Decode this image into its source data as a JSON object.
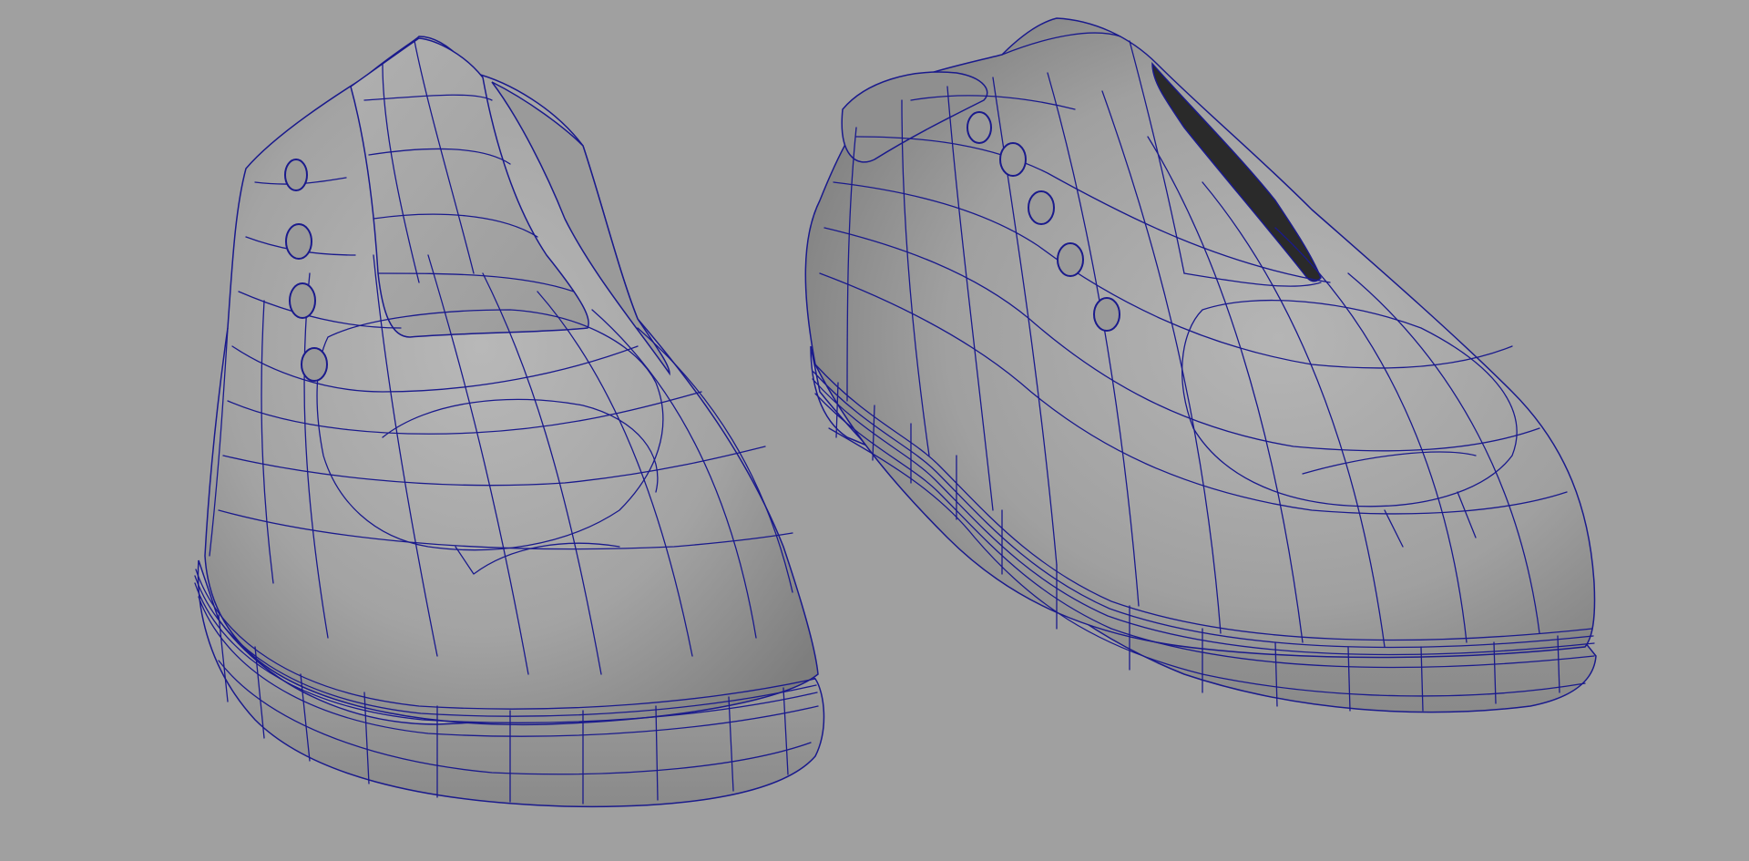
{
  "viewport": {
    "background_color": "#a0a0a0",
    "shading_color": "#a6a6a6",
    "wireframe_color": "#1a1a8c",
    "display_mode": "wireframe-on-shaded"
  },
  "scene": {
    "objects": [
      {
        "name": "shoe-left",
        "eyelet_count": 4
      },
      {
        "name": "shoe-right",
        "eyelet_count": 5
      }
    ]
  }
}
